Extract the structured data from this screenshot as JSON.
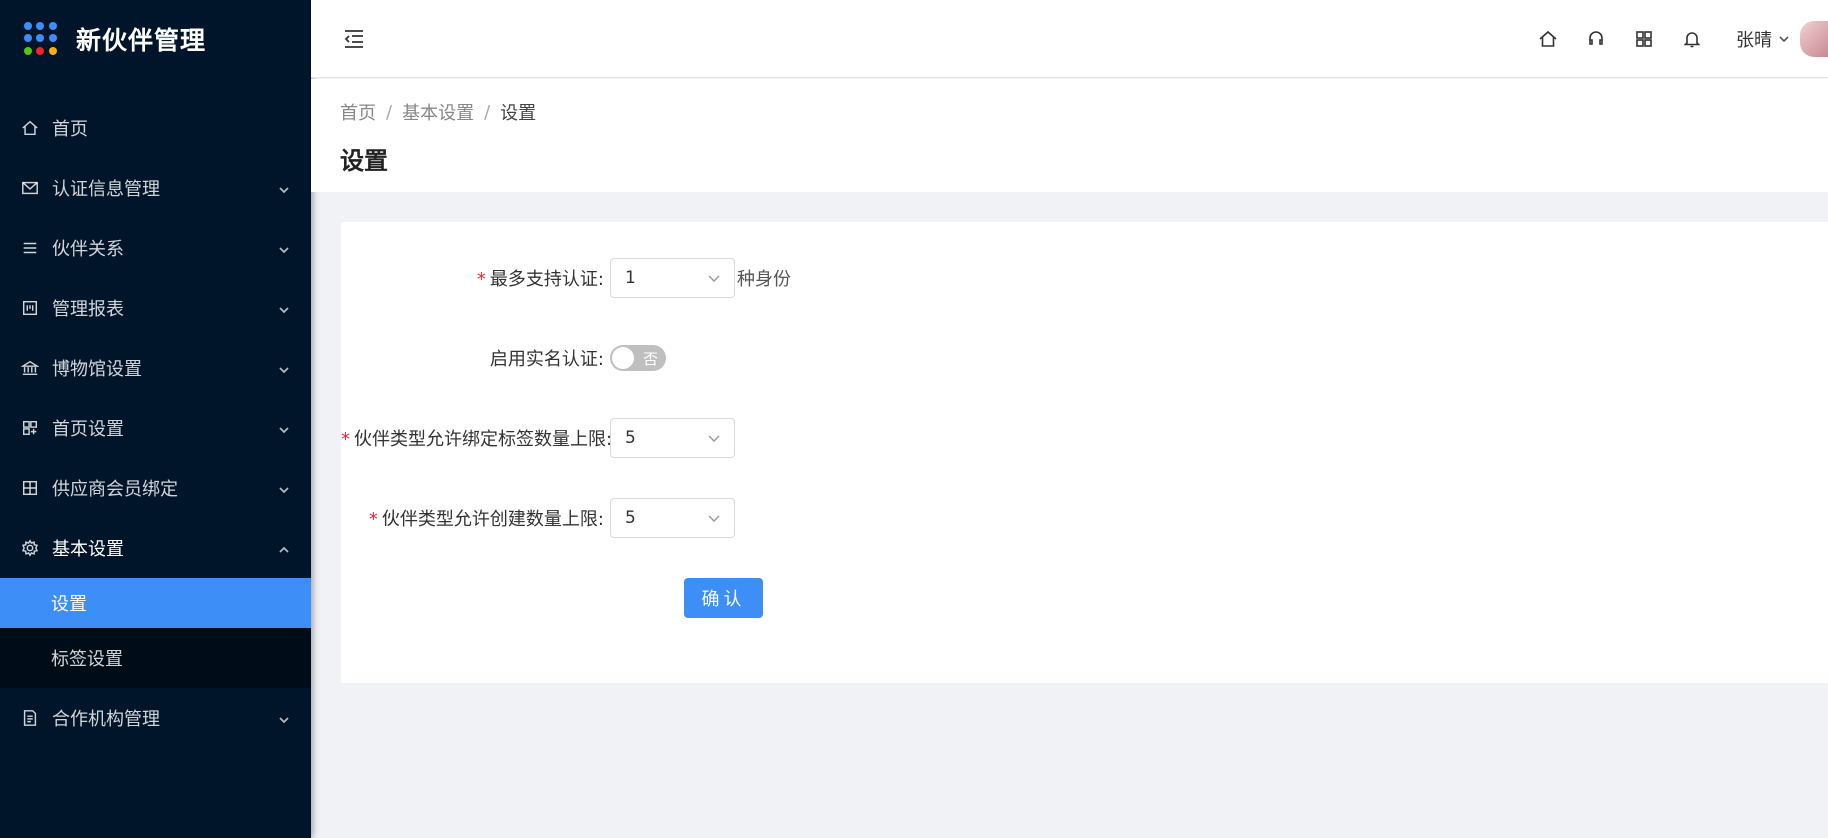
{
  "app": {
    "title": "新伙伴管理"
  },
  "sidebar": {
    "items": [
      {
        "label": "首页",
        "icon": "home-icon"
      },
      {
        "label": "认证信息管理",
        "icon": "mail-icon"
      },
      {
        "label": "伙伴关系",
        "icon": "list-icon"
      },
      {
        "label": "管理报表",
        "icon": "report-icon"
      },
      {
        "label": "博物馆设置",
        "icon": "bank-icon"
      },
      {
        "label": "首页设置",
        "icon": "layout-icon"
      },
      {
        "label": "供应商会员绑定",
        "icon": "grid-icon"
      },
      {
        "label": "基本设置",
        "icon": "gear-icon"
      },
      {
        "label": "合作机构管理",
        "icon": "file-icon"
      }
    ],
    "submenu": [
      {
        "label": "设置"
      },
      {
        "label": "标签设置"
      }
    ],
    "active_color": "#3e8ef7"
  },
  "header": {
    "user_name": "张晴"
  },
  "breadcrumb": {
    "items": [
      "首页",
      "基本设置",
      "设置"
    ],
    "separator": "/"
  },
  "page": {
    "title": "设置"
  },
  "form": {
    "max_identity": {
      "label": "最多支持认证:",
      "value": "1",
      "suffix": "种身份"
    },
    "real_name": {
      "label": "启用实名认证:",
      "switch_text": "否"
    },
    "tag_limit": {
      "label": "伙伴类型允许绑定标签数量上限:",
      "value": "5"
    },
    "create_limit": {
      "label": "伙伴类型允许创建数量上限:",
      "value": "5"
    },
    "required_mark": "*",
    "confirm_label": "确认"
  }
}
